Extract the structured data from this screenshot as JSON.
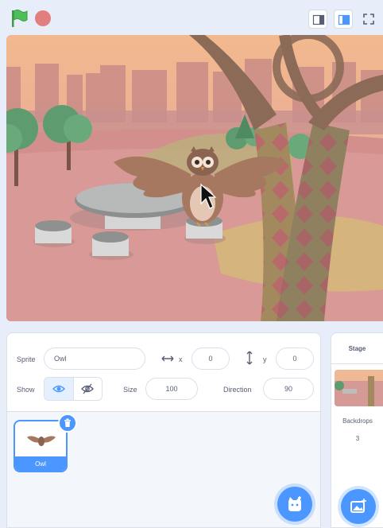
{
  "toolbar": {
    "green_flag_icon": "green-flag-icon",
    "stop_icon": "stop-icon",
    "flag_color": "#4cbf56",
    "stop_color": "#e26a6a"
  },
  "sprite_info": {
    "sprite_label": "Sprite",
    "sprite_name": "Owl",
    "x_label": "x",
    "x_value": "0",
    "y_label": "y",
    "y_value": "0",
    "show_label": "Show",
    "size_label": "Size",
    "size_value": "100",
    "direction_label": "Direction",
    "direction_value": "90"
  },
  "sprites": [
    {
      "name": "Owl",
      "selected": true
    }
  ],
  "stage_panel": {
    "title": "Stage",
    "backdrops_label": "Backdrops",
    "backdrops_count": "3"
  },
  "colors": {
    "accent": "#4c97ff",
    "background": "#e7eefa"
  }
}
